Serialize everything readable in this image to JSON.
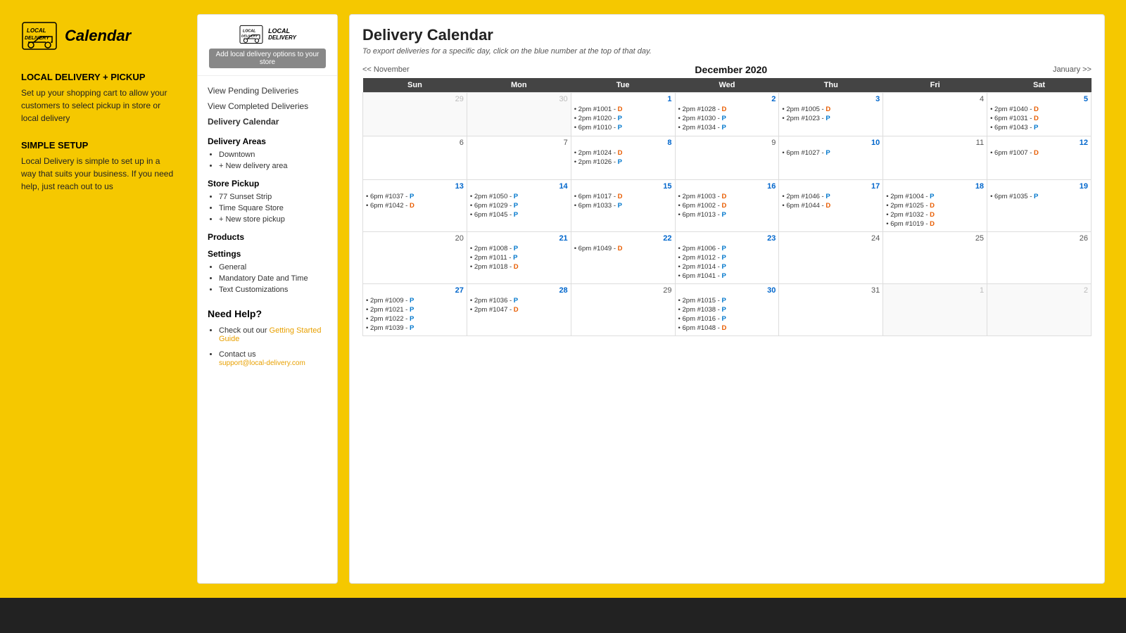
{
  "left": {
    "logo_text": "Calendar",
    "sections": [
      {
        "header": "LOCAL DELIVERY + PICKUP",
        "text": "Set up your shopping cart to allow your customers to select pickup in store or local delivery"
      },
      {
        "header": "SIMPLE SETUP",
        "text": "Local Delivery is simple to set up in a way that suits your business. If you need help, just reach out to us"
      }
    ]
  },
  "sidebar": {
    "logo_line1": "LOCAL",
    "logo_line2": "DELIVERY",
    "add_btn": "Add local delivery options to your store",
    "nav": [
      {
        "label": "View Pending Deliveries"
      },
      {
        "label": "View Completed Deliveries"
      },
      {
        "label": "Delivery Calendar"
      }
    ],
    "delivery_areas_title": "Delivery Areas",
    "delivery_areas": [
      {
        "label": "Downtown"
      },
      {
        "label": "+ New delivery area"
      }
    ],
    "store_pickup_title": "Store Pickup",
    "store_pickups": [
      {
        "label": "77 Sunset Strip"
      },
      {
        "label": "Time Square Store"
      },
      {
        "label": "+ New store pickup"
      }
    ],
    "products_title": "Products",
    "settings_title": "Settings",
    "settings_items": [
      {
        "label": "General"
      },
      {
        "label": "Mandatory Date and Time"
      },
      {
        "label": "Text Customizations"
      }
    ],
    "need_help_title": "Need Help?",
    "help_items": [
      {
        "label": "Check out our ",
        "link_text": "Getting Started Guide",
        "extra": ""
      },
      {
        "label": "Contact us",
        "link": "",
        "sub": "support@local-delivery.com"
      }
    ]
  },
  "calendar": {
    "title": "Delivery Calendar",
    "subtitle": "To export deliveries for a specific day, click on the blue number at the top of that day.",
    "prev_label": "<< November",
    "next_label": "January >>",
    "month_title": "December 2020",
    "headers": [
      "Sun",
      "Mon",
      "Tue",
      "Wed",
      "Thu",
      "Fri",
      "Sat"
    ],
    "weeks": [
      [
        {
          "day": "29",
          "other": true,
          "entries": []
        },
        {
          "day": "30",
          "other": true,
          "entries": []
        },
        {
          "day": "1",
          "blue": true,
          "entries": [
            {
              "time": "2pm",
              "order": "#1001",
              "status": "D"
            },
            {
              "time": "2pm",
              "order": "#1020",
              "status": "P"
            },
            {
              "time": "6pm",
              "order": "#1010",
              "status": "P"
            }
          ]
        },
        {
          "day": "2",
          "blue": true,
          "entries": [
            {
              "time": "2pm",
              "order": "#1028",
              "status": "D"
            },
            {
              "time": "2pm",
              "order": "#1030",
              "status": "P"
            },
            {
              "time": "2pm",
              "order": "#1034",
              "status": "P"
            }
          ]
        },
        {
          "day": "3",
          "blue": true,
          "entries": [
            {
              "time": "2pm",
              "order": "#1005",
              "status": "D"
            },
            {
              "time": "2pm",
              "order": "#1023",
              "status": "P"
            }
          ]
        },
        {
          "day": "4",
          "entries": []
        },
        {
          "day": "5",
          "blue": true,
          "entries": [
            {
              "time": "2pm",
              "order": "#1040",
              "status": "D"
            },
            {
              "time": "6pm",
              "order": "#1031",
              "status": "D"
            },
            {
              "time": "6pm",
              "order": "#1043",
              "status": "P"
            }
          ]
        }
      ],
      [
        {
          "day": "6",
          "entries": []
        },
        {
          "day": "7",
          "entries": []
        },
        {
          "day": "8",
          "blue": true,
          "entries": [
            {
              "time": "2pm",
              "order": "#1024",
              "status": "D"
            },
            {
              "time": "2pm",
              "order": "#1026",
              "status": "P"
            }
          ]
        },
        {
          "day": "9",
          "entries": []
        },
        {
          "day": "10",
          "blue": true,
          "entries": [
            {
              "time": "6pm",
              "order": "#1027",
              "status": "P"
            }
          ]
        },
        {
          "day": "11",
          "entries": []
        },
        {
          "day": "12",
          "blue": true,
          "entries": [
            {
              "time": "6pm",
              "order": "#1007",
              "status": "D"
            }
          ]
        }
      ],
      [
        {
          "day": "13",
          "blue": true,
          "entries": [
            {
              "time": "6pm",
              "order": "#1037",
              "status": "P"
            },
            {
              "time": "6pm",
              "order": "#1042",
              "status": "D"
            }
          ]
        },
        {
          "day": "14",
          "blue": true,
          "entries": [
            {
              "time": "2pm",
              "order": "#1050",
              "status": "P"
            },
            {
              "time": "6pm",
              "order": "#1029",
              "status": "P"
            },
            {
              "time": "6pm",
              "order": "#1045",
              "status": "P"
            }
          ]
        },
        {
          "day": "15",
          "blue": true,
          "entries": [
            {
              "time": "6pm",
              "order": "#1017",
              "status": "D"
            },
            {
              "time": "6pm",
              "order": "#1033",
              "status": "P"
            }
          ]
        },
        {
          "day": "16",
          "blue": true,
          "entries": [
            {
              "time": "2pm",
              "order": "#1003",
              "status": "D"
            },
            {
              "time": "6pm",
              "order": "#1002",
              "status": "D"
            },
            {
              "time": "6pm",
              "order": "#1013",
              "status": "P"
            }
          ]
        },
        {
          "day": "17",
          "blue": true,
          "entries": [
            {
              "time": "2pm",
              "order": "#1046",
              "status": "P"
            },
            {
              "time": "6pm",
              "order": "#1044",
              "status": "D"
            }
          ]
        },
        {
          "day": "18",
          "blue": true,
          "entries": [
            {
              "time": "2pm",
              "order": "#1004",
              "status": "P"
            },
            {
              "time": "2pm",
              "order": "#1025",
              "status": "D"
            },
            {
              "time": "2pm",
              "order": "#1032",
              "status": "D"
            },
            {
              "time": "6pm",
              "order": "#1019",
              "status": "D"
            }
          ]
        },
        {
          "day": "19",
          "blue": true,
          "entries": [
            {
              "time": "6pm",
              "order": "#1035",
              "status": "P"
            }
          ]
        }
      ],
      [
        {
          "day": "20",
          "entries": []
        },
        {
          "day": "21",
          "blue": true,
          "entries": [
            {
              "time": "2pm",
              "order": "#1008",
              "status": "P"
            },
            {
              "time": "2pm",
              "order": "#1011",
              "status": "P"
            },
            {
              "time": "2pm",
              "order": "#1018",
              "status": "D"
            }
          ]
        },
        {
          "day": "22",
          "blue": true,
          "entries": [
            {
              "time": "6pm",
              "order": "#1049",
              "status": "D"
            }
          ]
        },
        {
          "day": "23",
          "blue": true,
          "entries": [
            {
              "time": "2pm",
              "order": "#1006",
              "status": "P"
            },
            {
              "time": "2pm",
              "order": "#1012",
              "status": "P"
            },
            {
              "time": "2pm",
              "order": "#1014",
              "status": "P"
            },
            {
              "time": "6pm",
              "order": "#1041",
              "status": "P"
            }
          ]
        },
        {
          "day": "24",
          "entries": []
        },
        {
          "day": "25",
          "entries": []
        },
        {
          "day": "26",
          "entries": []
        }
      ],
      [
        {
          "day": "27",
          "blue": true,
          "entries": [
            {
              "time": "2pm",
              "order": "#1009",
              "status": "P"
            },
            {
              "time": "2pm",
              "order": "#1021",
              "status": "P"
            },
            {
              "time": "2pm",
              "order": "#1022",
              "status": "P"
            },
            {
              "time": "2pm",
              "order": "#1039",
              "status": "P"
            }
          ]
        },
        {
          "day": "28",
          "blue": true,
          "entries": [
            {
              "time": "2pm",
              "order": "#1036",
              "status": "P"
            },
            {
              "time": "2pm",
              "order": "#1047",
              "status": "D"
            }
          ]
        },
        {
          "day": "29",
          "entries": []
        },
        {
          "day": "30",
          "blue": true,
          "entries": [
            {
              "time": "2pm",
              "order": "#1015",
              "status": "P"
            },
            {
              "time": "2pm",
              "order": "#1038",
              "status": "P"
            },
            {
              "time": "6pm",
              "order": "#1016",
              "status": "P"
            },
            {
              "time": "6pm",
              "order": "#1048",
              "status": "D"
            }
          ]
        },
        {
          "day": "31",
          "entries": []
        },
        {
          "day": "1",
          "other": true,
          "entries": []
        },
        {
          "day": "2",
          "other": true,
          "entries": []
        }
      ]
    ]
  }
}
